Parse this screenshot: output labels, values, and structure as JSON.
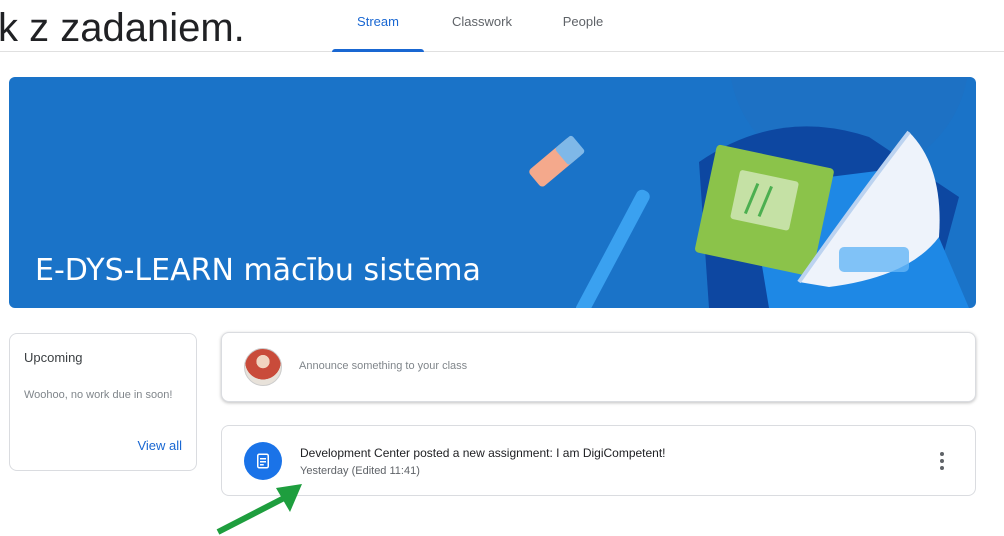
{
  "overlay_caption": "k z zadaniem.",
  "tabs": [
    {
      "label": "Stream",
      "active": true
    },
    {
      "label": "Classwork",
      "active": false
    },
    {
      "label": "People",
      "active": false
    }
  ],
  "banner": {
    "title": "E-DYS-LEARN mācību sistēma",
    "background_color": "#1a73c8"
  },
  "upcoming": {
    "title": "Upcoming",
    "message": "Woohoo, no work due in soon!",
    "view_all": "View all"
  },
  "announce": {
    "placeholder": "Announce something to your class"
  },
  "post": {
    "icon": "assignment-icon",
    "headline": "Development Center posted a new assignment: I am DigiCompetent!",
    "meta": "Yesterday (Edited 11:41)"
  },
  "colors": {
    "accent": "#1967d2",
    "annotation_arrow": "#1e9e3e"
  }
}
